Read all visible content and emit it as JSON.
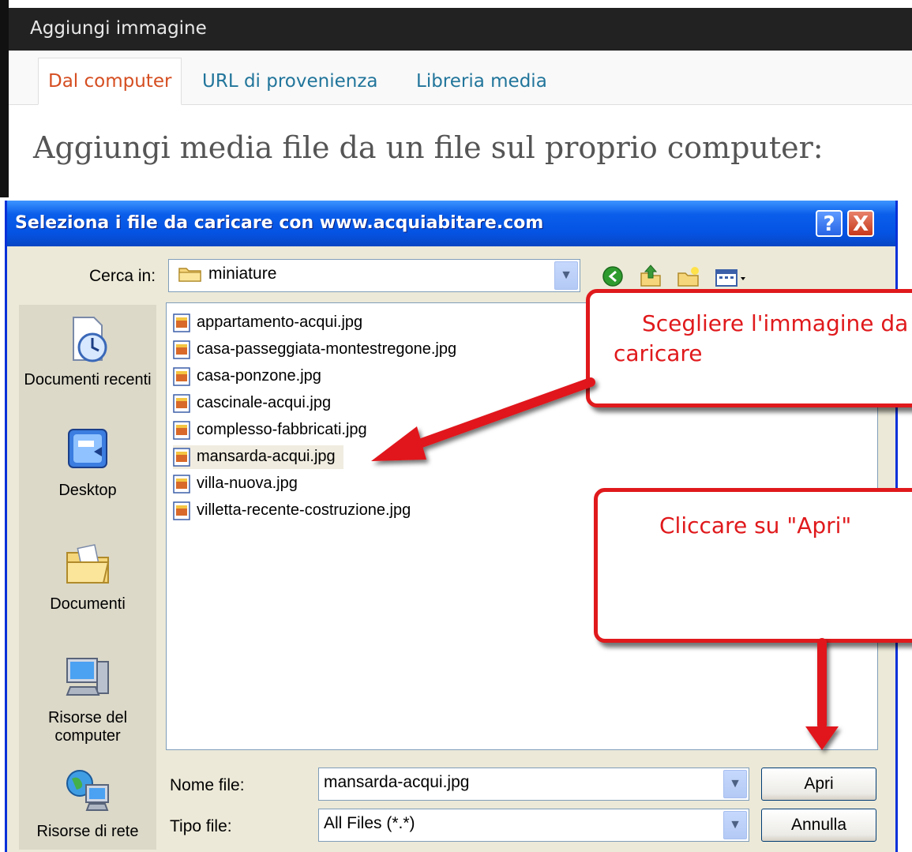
{
  "wp": {
    "title": "Aggiungi immagine",
    "tabs": [
      {
        "label": "Dal computer",
        "active": true
      },
      {
        "label": "URL di provenienza",
        "active": false
      },
      {
        "label": "Libreria media",
        "active": false
      }
    ],
    "heading": "Aggiungi media file da un file sul proprio computer:"
  },
  "dialog": {
    "title": "Seleziona i file da caricare con www.acquiabitare.com",
    "help_label": "?",
    "close_label": "X",
    "look_in_label": "Cerca in:",
    "look_in_value": "miniature",
    "places": [
      {
        "label": "Documenti recenti",
        "icon": "recent-documents-icon"
      },
      {
        "label": "Desktop",
        "icon": "desktop-icon"
      },
      {
        "label": "Documenti",
        "icon": "documents-folder-icon"
      },
      {
        "label": "Risorse del computer",
        "icon": "my-computer-icon"
      },
      {
        "label": "Risorse di rete",
        "icon": "network-icon"
      }
    ],
    "files": [
      "appartamento-acqui.jpg",
      "casa-passeggiata-montestregone.jpg",
      "casa-ponzone.jpg",
      "cascinale-acqui.jpg",
      "complesso-fabbricati.jpg",
      "mansarda-acqui.jpg",
      "villa-nuova.jpg",
      "villetta-recente-costruzione.jpg"
    ],
    "selected_file": "mansarda-acqui.jpg",
    "filename_label": "Nome file:",
    "filename_value": "mansarda-acqui.jpg",
    "filetype_label": "Tipo file:",
    "filetype_value": "All Files (*.*)",
    "open_label": "Apri",
    "cancel_label": "Annulla"
  },
  "callouts": {
    "choose_line1": "Scegliere l'immagine da",
    "choose_line2": "caricare",
    "click_open": "Cliccare su \"Apri\""
  },
  "colors": {
    "callout_red": "#e0191c",
    "xp_title_blue": "#0553e3",
    "wp_active_tab": "#d54e21",
    "wp_link": "#21759b"
  }
}
